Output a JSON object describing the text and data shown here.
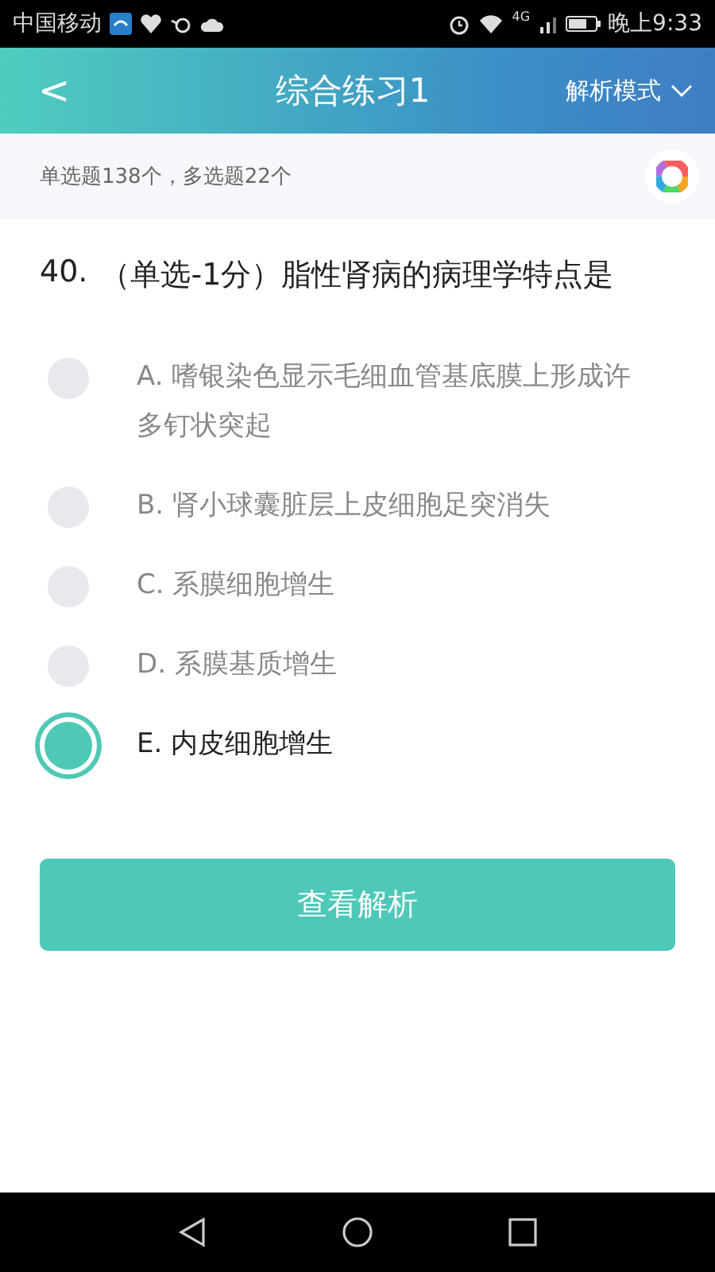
{
  "status_bar": {
    "carrier": "中国移动",
    "network": "4G",
    "time": "晚上9:33"
  },
  "header": {
    "back": "<",
    "title": "综合练习1",
    "mode": "解析模式"
  },
  "info": {
    "summary": "单选题138个，多选题22个"
  },
  "question": {
    "number": "40.",
    "text": "（单选-1分）脂性肾病的病理学特点是",
    "options": [
      {
        "label": "A. 嗜银染色显示毛细血管基底膜上形成许多钉状突起",
        "selected": false
      },
      {
        "label": "B. 肾小球囊脏层上皮细胞足突消失",
        "selected": false
      },
      {
        "label": "C. 系膜细胞增生",
        "selected": false
      },
      {
        "label": "D. 系膜基质增生",
        "selected": false
      },
      {
        "label": "E. 内皮细胞增生",
        "selected": true
      }
    ]
  },
  "action": {
    "label": "查看解析"
  }
}
